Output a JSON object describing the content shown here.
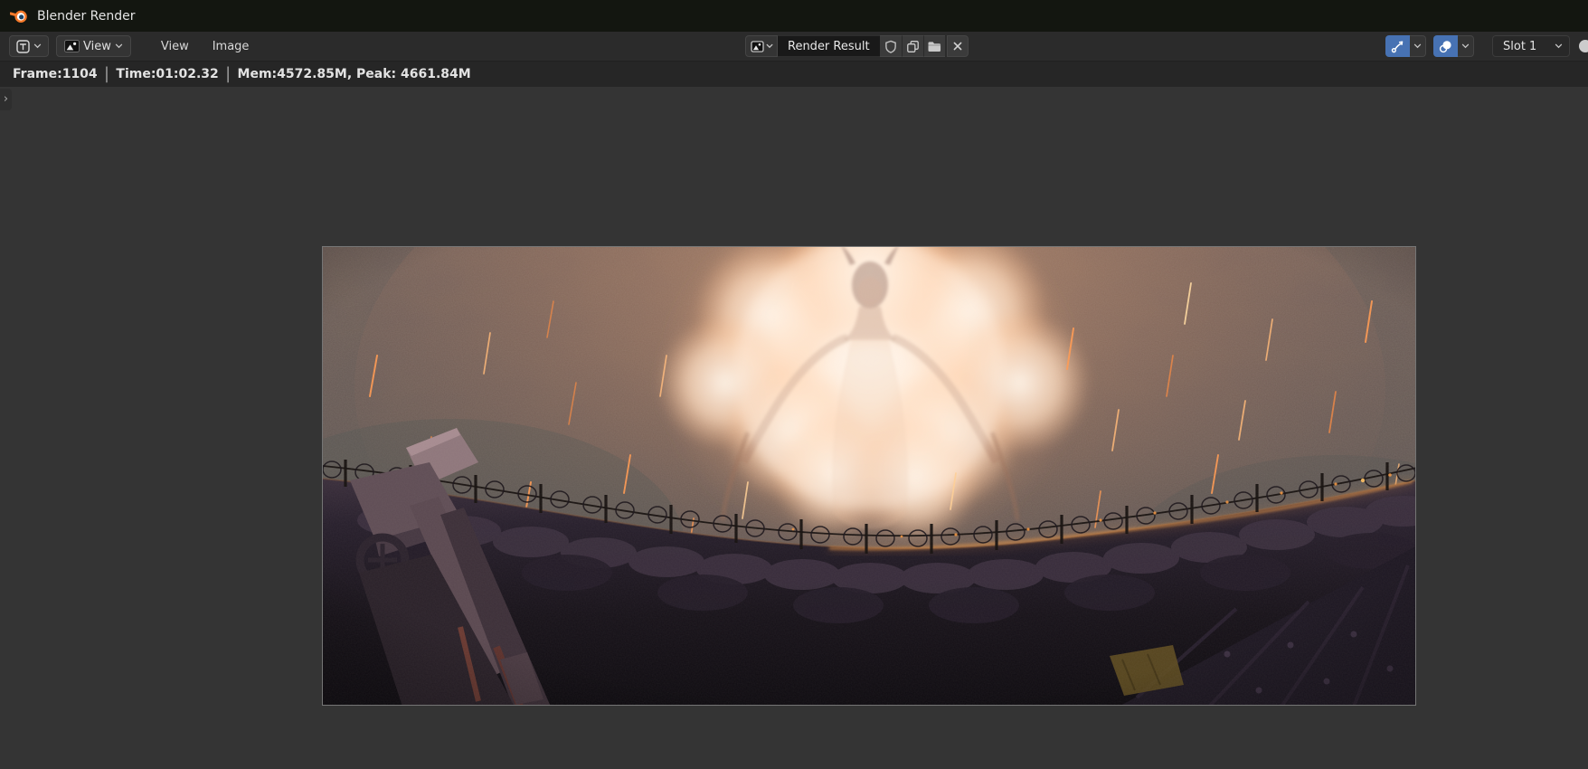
{
  "window": {
    "title": "Blender Render",
    "app_icon": "blender-logo-icon"
  },
  "header": {
    "editor_type_button": {
      "icon": "image-editor-icon"
    },
    "mode_dropdown": {
      "icon": "image-thumbnail-icon",
      "label": "View"
    },
    "menus": [
      {
        "label": "View"
      },
      {
        "label": "Image"
      }
    ],
    "image_datablock": {
      "browse_icon": "image-browse-icon",
      "name": "Render Result",
      "fake_user_icon": "shield-icon",
      "new_image_icon": "duplicate-icon",
      "open_image_icon": "folder-icon",
      "unlink_icon": "close-x-icon"
    },
    "right_controls": {
      "gizmo_toggle": {
        "icon": "gizmo-arrow-icon",
        "enabled": true
      },
      "overlay_toggle": {
        "icon": "overlays-icon",
        "enabled": true
      },
      "render_slot": {
        "label": "Slot 1"
      },
      "display_channels_icon": "color-circle-icon"
    }
  },
  "render_info_bar": {
    "frame": "Frame:1104",
    "separator": "|",
    "time": "Time:01:02.32",
    "memory": "Mem:4572.85M, Peak: 4661.84M"
  },
  "viewport": {
    "sidebar_toggle_glyph": "›",
    "render_preview_alt": "Rendered frame: glowing white-orange explosion cloud with a faint horned figure, orange sparks falling over a dark arena crowd, dark barbed-wire barricade and broken wooden siege gear along the bottom"
  },
  "colors": {
    "accent_blue": "#4772b3",
    "titlebar_bg": "#131610",
    "header_bg": "#2b2b2b",
    "info_bar_bg": "#262626",
    "viewport_bg": "#343434",
    "name_field_bg": "#191919",
    "glow_core": "#fff7ee",
    "spark_orange": "#ff9a52",
    "wall_dark": "#181219"
  }
}
